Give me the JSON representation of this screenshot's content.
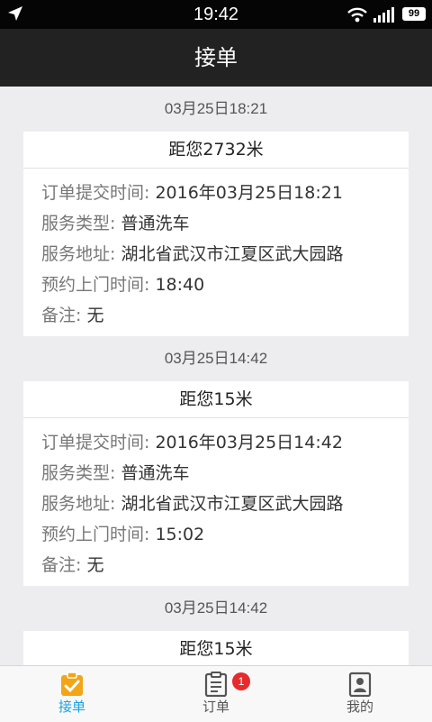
{
  "status_bar": {
    "time": "19:42",
    "battery": "99",
    "icons": [
      "location-arrow-icon",
      "wifi-icon",
      "signal-icon",
      "battery-icon"
    ]
  },
  "header": {
    "title": "接单"
  },
  "labels": {
    "submit_time": "订单提交时间:",
    "service_type": "服务类型:",
    "service_address": "服务地址:",
    "appointment_time": "预约上门时间:",
    "remark": "备注:"
  },
  "orders": [
    {
      "group_time": "03月25日18:21",
      "distance": "距您2732米",
      "submit_time": "2016年03月25日18:21",
      "service_type": "普通洗车",
      "service_address": "湖北省武汉市江夏区武大园路",
      "appointment_time": "18:40",
      "remark": "无"
    },
    {
      "group_time": "03月25日14:42",
      "distance": "距您15米",
      "submit_time": "2016年03月25日14:42",
      "service_type": "普通洗车",
      "service_address": "湖北省武汉市江夏区武大园路",
      "appointment_time": "15:02",
      "remark": "无"
    },
    {
      "group_time": "03月25日14:42",
      "distance": "距您15米"
    }
  ],
  "tabbar": {
    "items": [
      {
        "label": "接单",
        "icon": "clipboard-check-icon",
        "active": true
      },
      {
        "label": "订单",
        "icon": "order-list-icon",
        "badge": "1"
      },
      {
        "label": "我的",
        "icon": "profile-card-icon"
      }
    ],
    "active_color": "#1aa3e0"
  }
}
